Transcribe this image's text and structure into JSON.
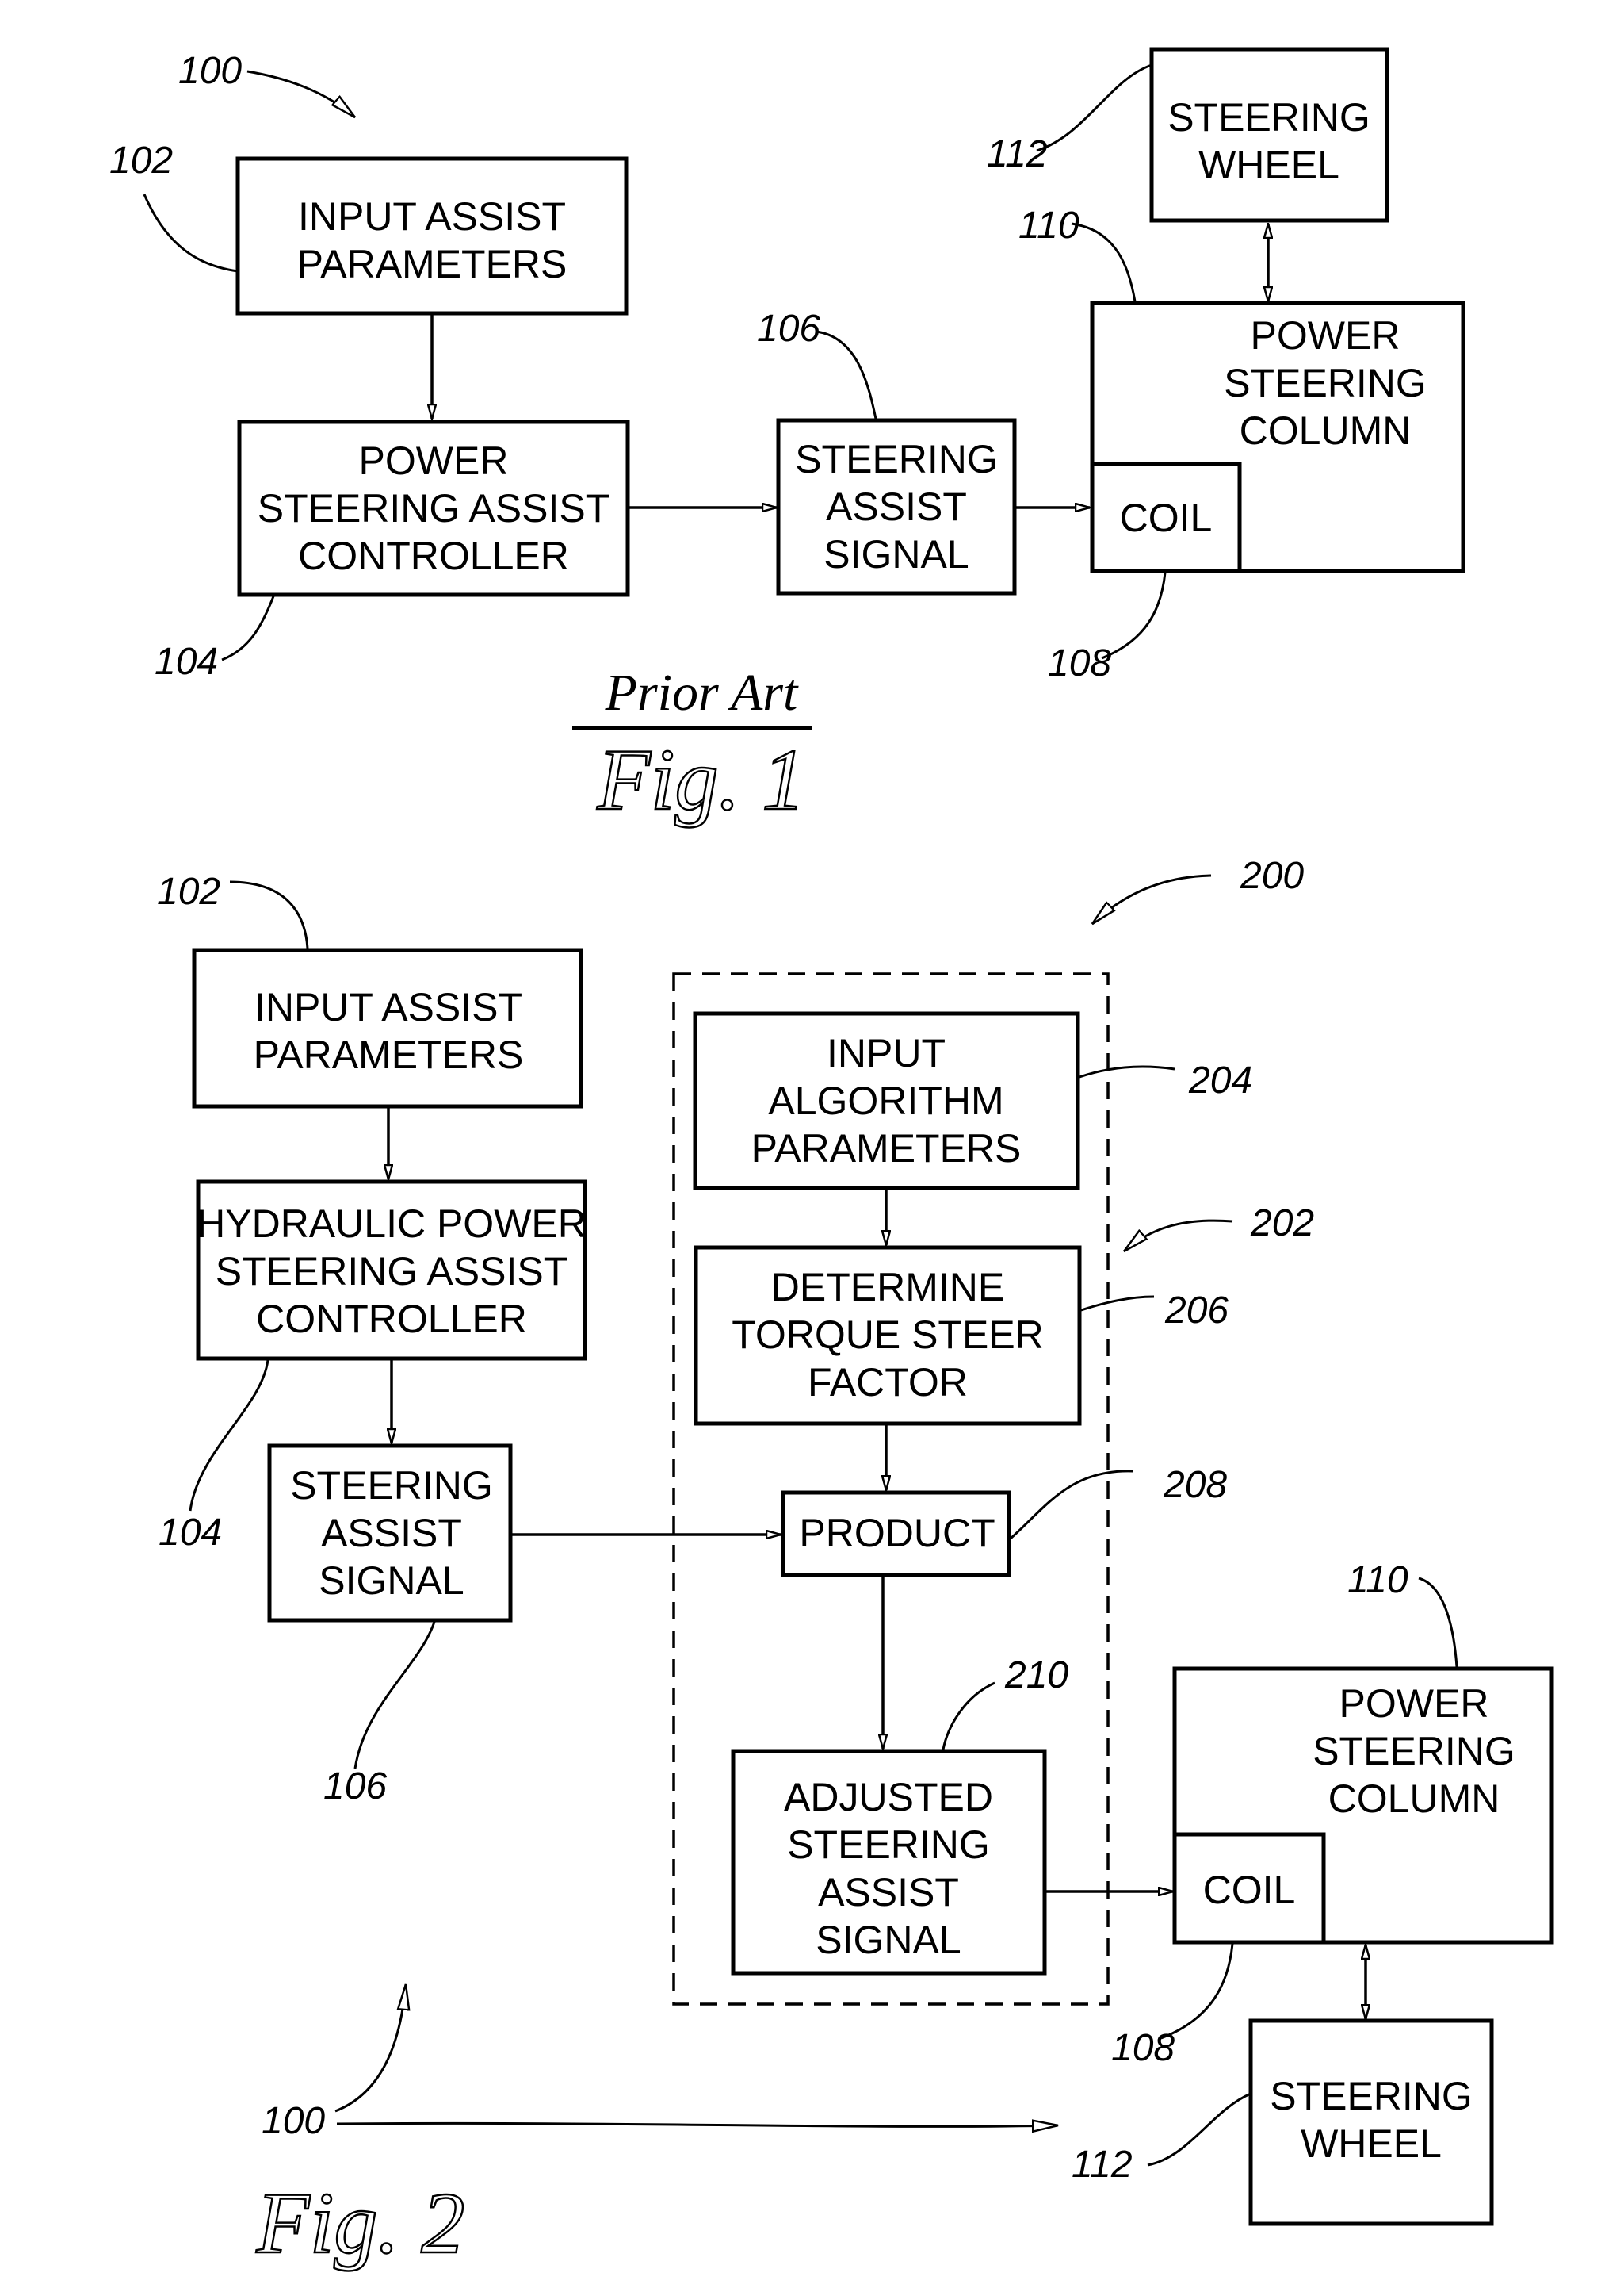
{
  "figure1": {
    "caption_prior_art": "Prior Art",
    "caption_fig": "Fig. 1",
    "system_ref": "100",
    "blocks": {
      "input_assist_parameters": {
        "ref": "102",
        "lines": [
          "INPUT ASSIST",
          "PARAMETERS"
        ]
      },
      "power_steering_assist_controller": {
        "ref": "104",
        "lines": [
          "POWER",
          "STEERING ASSIST",
          "CONTROLLER"
        ]
      },
      "steering_assist_signal": {
        "ref": "106",
        "lines": [
          "STEERING",
          "ASSIST",
          "SIGNAL"
        ]
      },
      "coil": {
        "ref": "108",
        "lines": [
          "COIL"
        ]
      },
      "power_steering_column": {
        "ref": "110",
        "lines": [
          "POWER",
          "STEERING",
          "COLUMN"
        ]
      },
      "steering_wheel": {
        "ref": "112",
        "lines": [
          "STEERING",
          "WHEEL"
        ]
      }
    }
  },
  "figure2": {
    "caption_fig": "Fig. 2",
    "system_ref": "200",
    "prior_system_ref": "100",
    "algorithm_group_ref": "202",
    "blocks": {
      "input_assist_parameters": {
        "ref": "102",
        "lines": [
          "INPUT ASSIST",
          "PARAMETERS"
        ]
      },
      "hydraulic_power_steering_assist_controller": {
        "ref": "104",
        "lines": [
          "HYDRAULIC POWER",
          "STEERING ASSIST",
          "CONTROLLER"
        ]
      },
      "steering_assist_signal": {
        "ref": "106",
        "lines": [
          "STEERING",
          "ASSIST",
          "SIGNAL"
        ]
      },
      "input_algorithm_parameters": {
        "ref": "204",
        "lines": [
          "INPUT",
          "ALGORITHM",
          "PARAMETERS"
        ]
      },
      "determine_torque_steer_factor": {
        "ref": "206",
        "lines": [
          "DETERMINE",
          "TORQUE STEER",
          "FACTOR"
        ]
      },
      "product": {
        "ref": "208",
        "lines": [
          "PRODUCT"
        ]
      },
      "adjusted_steering_assist_signal": {
        "ref": "210",
        "lines": [
          "ADJUSTED",
          "STEERING",
          "ASSIST",
          "SIGNAL"
        ]
      },
      "coil": {
        "ref": "108",
        "lines": [
          "COIL"
        ]
      },
      "power_steering_column": {
        "ref": "110",
        "lines": [
          "POWER",
          "STEERING",
          "COLUMN"
        ]
      },
      "steering_wheel": {
        "ref": "112",
        "lines": [
          "STEERING",
          "WHEEL"
        ]
      }
    }
  }
}
